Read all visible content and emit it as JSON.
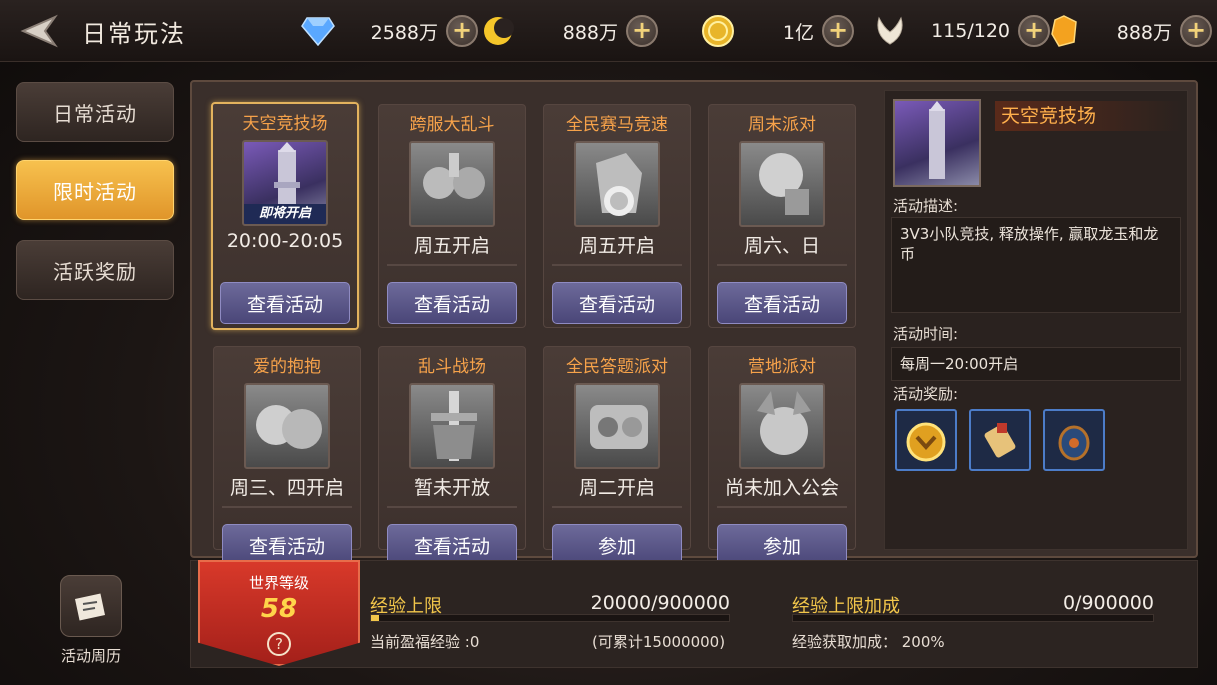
{
  "header": {
    "title": "日常玩法",
    "resources": [
      {
        "icon": "diamond-icon",
        "value": "2588万"
      },
      {
        "icon": "crescent-icon",
        "value": "888万"
      },
      {
        "icon": "gold-coin-icon",
        "value": "1亿"
      },
      {
        "icon": "wings-icon",
        "value": "115/120"
      },
      {
        "icon": "crystal-icon",
        "value": "888万"
      }
    ]
  },
  "tabs": [
    {
      "label": "日常活动",
      "active": false
    },
    {
      "label": "限时活动",
      "active": true
    },
    {
      "label": "活跃奖励",
      "active": false
    }
  ],
  "cards": [
    {
      "title": "天空竞技场",
      "time": "20:00-20:05",
      "button": "查看活动",
      "badge": "即将开启",
      "selected": true
    },
    {
      "title": "跨服大乱斗",
      "time": "周五开启",
      "button": "查看活动"
    },
    {
      "title": "全民赛马竞速",
      "time": "周五开启",
      "button": "查看活动"
    },
    {
      "title": "周末派对",
      "time": "周六、日",
      "button": "查看活动"
    },
    {
      "title": "爱的抱抱",
      "time": "周三、四开启",
      "button": "查看活动"
    },
    {
      "title": "乱斗战场",
      "time": "暂未开放",
      "button": "查看活动"
    },
    {
      "title": "全民答题派对",
      "time": "周二开启",
      "button": "参加"
    },
    {
      "title": "营地派对",
      "time": "尚未加入公会",
      "button": "参加"
    }
  ],
  "detail": {
    "title": "天空竞技场",
    "desc_label": "活动描述:",
    "desc": "3V3小队竞技, 释放操作, 赢取龙玉和龙币",
    "time_label": "活动时间:",
    "time": "每周一20:00开启",
    "reward_label": "活动奖励:",
    "rewards": [
      "medal-icon",
      "scroll-icon",
      "lantern-icon"
    ]
  },
  "bottom": {
    "world_level_label": "世界等级",
    "world_level": "58",
    "help": "?",
    "exp_cap_label": "经验上限",
    "exp_cap_value": "20000/900000",
    "exp_progress": 0.022,
    "exp_bonus_label": "经验上限加成",
    "exp_bonus_value": "0/900000",
    "surplus_exp": "当前盈福经验 :0",
    "accumulate": "(可累计15000000)",
    "gain_bonus": "经验获取加成： 200%"
  },
  "calendar": {
    "label": "活动周历"
  },
  "colors": {
    "accent": "#f6a24a",
    "tab_active": "#f2b344",
    "button": "#5a5688"
  }
}
